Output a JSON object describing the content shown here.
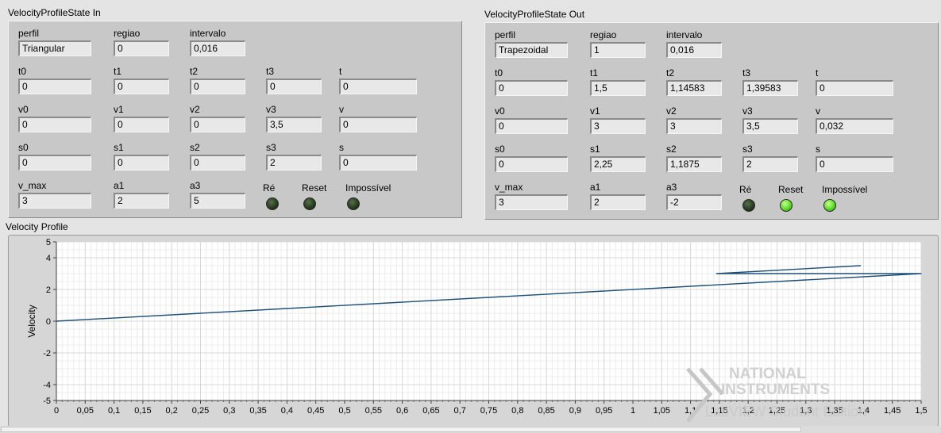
{
  "state_in": {
    "title": "VelocityProfileState In",
    "fields": [
      {
        "label": "perfil",
        "value": "Triangular"
      },
      {
        "label": "regiao",
        "value": "0"
      },
      {
        "label": "intervalo",
        "value": "0,016"
      },
      {
        "label": "t0",
        "value": "0"
      },
      {
        "label": "t1",
        "value": "0"
      },
      {
        "label": "t2",
        "value": "0"
      },
      {
        "label": "t3",
        "value": "0"
      },
      {
        "label": "t",
        "value": "0"
      },
      {
        "label": "v0",
        "value": "0"
      },
      {
        "label": "v1",
        "value": "0"
      },
      {
        "label": "v2",
        "value": "0"
      },
      {
        "label": "v3",
        "value": "3,5"
      },
      {
        "label": "v",
        "value": "0"
      },
      {
        "label": "s0",
        "value": "0"
      },
      {
        "label": "s1",
        "value": "0"
      },
      {
        "label": "s2",
        "value": "0"
      },
      {
        "label": "s3",
        "value": "2"
      },
      {
        "label": "s",
        "value": "0"
      },
      {
        "label": "v_max",
        "value": "3"
      },
      {
        "label": "a1",
        "value": "2"
      },
      {
        "label": "a3",
        "value": "5"
      }
    ],
    "leds": [
      {
        "label": "Ré",
        "on": false
      },
      {
        "label": "Reset",
        "on": false
      },
      {
        "label": "Impossível",
        "on": false
      }
    ]
  },
  "state_out": {
    "title": "VelocityProfileState Out",
    "fields": [
      {
        "label": "perfil",
        "value": "Trapezoidal"
      },
      {
        "label": "regiao",
        "value": "1"
      },
      {
        "label": "intervalo",
        "value": "0,016"
      },
      {
        "label": "t0",
        "value": "0"
      },
      {
        "label": "t1",
        "value": "1,5"
      },
      {
        "label": "t2",
        "value": "1,14583"
      },
      {
        "label": "t3",
        "value": "1,39583"
      },
      {
        "label": "t",
        "value": "0"
      },
      {
        "label": "v0",
        "value": "0"
      },
      {
        "label": "v1",
        "value": "3"
      },
      {
        "label": "v2",
        "value": "3"
      },
      {
        "label": "v3",
        "value": "3,5"
      },
      {
        "label": "v",
        "value": "0,032"
      },
      {
        "label": "s0",
        "value": "0"
      },
      {
        "label": "s1",
        "value": "2,25"
      },
      {
        "label": "s2",
        "value": "1,1875"
      },
      {
        "label": "s3",
        "value": "2"
      },
      {
        "label": "s",
        "value": "0"
      },
      {
        "label": "v_max",
        "value": "3"
      },
      {
        "label": "a1",
        "value": "2"
      },
      {
        "label": "a3",
        "value": "-2"
      }
    ],
    "leds": [
      {
        "label": "Ré",
        "on": false
      },
      {
        "label": "Reset",
        "on": true
      },
      {
        "label": "Impossível",
        "on": true
      }
    ]
  },
  "graph": {
    "title": "Velocity Profile",
    "watermark_brand_line1": "NATIONAL",
    "watermark_brand_line2": "INSTRUMENTS",
    "watermark_edition": "LabVIEW Student Edition"
  },
  "colors": {
    "panel_bg": "#c8c8c8",
    "plot_bg": "#ffffff",
    "trace": "#1c4f7a",
    "led_on": "#62e02c",
    "led_off": "#2a3e22"
  },
  "chart_data": {
    "type": "line",
    "title": "Velocity Profile",
    "xlabel": "",
    "ylabel": "Velocity",
    "xlim": [
      0,
      1.5
    ],
    "ylim": [
      -5,
      5
    ],
    "xticks": [
      "0",
      "0,05",
      "0,1",
      "0,15",
      "0,2",
      "0,25",
      "0,3",
      "0,35",
      "0,4",
      "0,45",
      "0,5",
      "0,55",
      "0,6",
      "0,65",
      "0,7",
      "0,75",
      "0,8",
      "0,85",
      "0,9",
      "0,95",
      "1",
      "1,05",
      "1,1",
      "1,15",
      "1,2",
      "1,25",
      "1,3",
      "1,35",
      "1,4",
      "1,45",
      "1,5"
    ],
    "yticks": [
      "-5",
      "-4",
      "-2",
      "0",
      "2",
      "4",
      "5"
    ],
    "grid": true,
    "series": [
      {
        "x": [
          0,
          1.5,
          1.145,
          1.395
        ],
        "y": [
          0,
          3,
          3,
          3.5
        ]
      }
    ]
  }
}
